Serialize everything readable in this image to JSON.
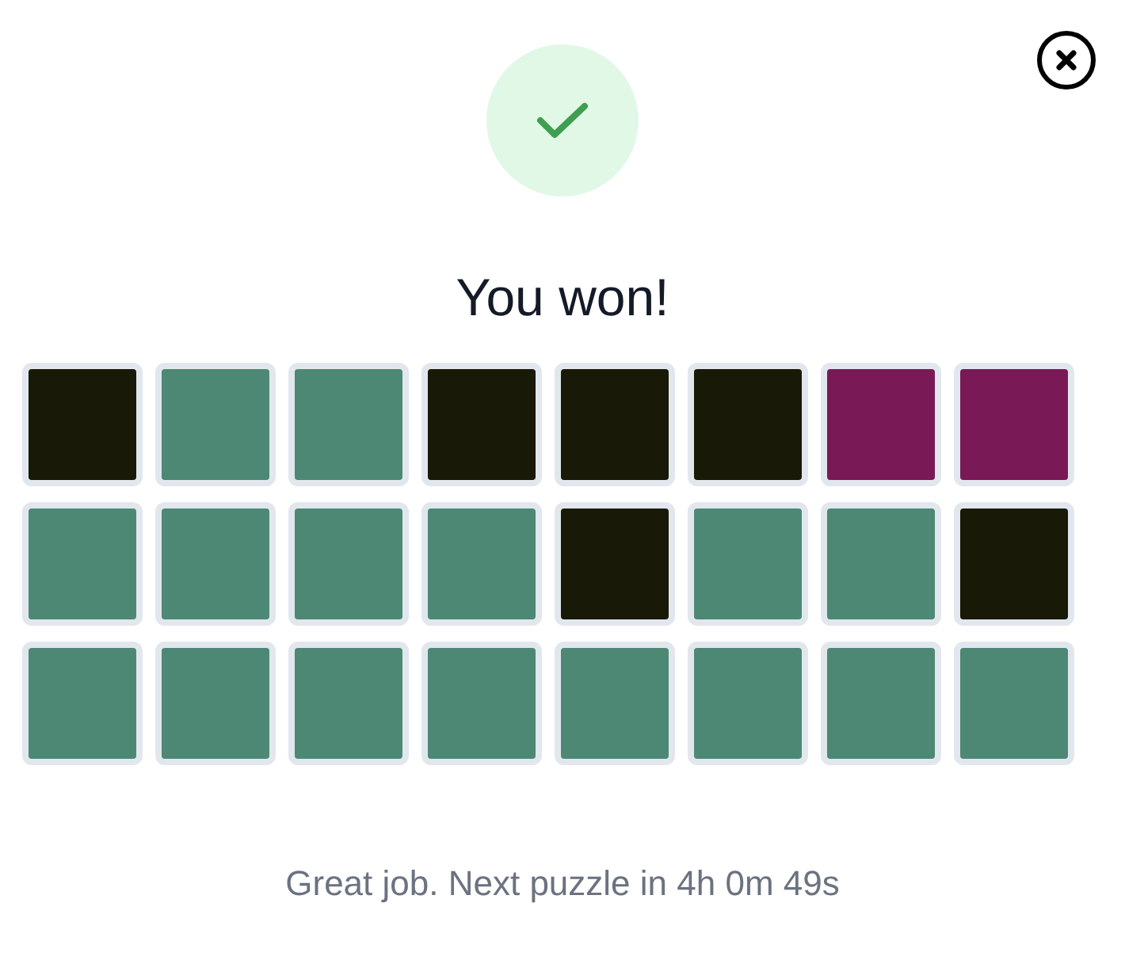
{
  "title": "You won!",
  "tiles": [
    [
      {
        "color": "#181906"
      },
      {
        "color": "#4d8874"
      },
      {
        "color": "#4d8874"
      },
      {
        "color": "#181906"
      },
      {
        "color": "#181906"
      },
      {
        "color": "#181906"
      },
      {
        "color": "#791a57"
      },
      {
        "color": "#791a57"
      }
    ],
    [
      {
        "color": "#4d8874"
      },
      {
        "color": "#4d8874"
      },
      {
        "color": "#4d8874"
      },
      {
        "color": "#4d8874"
      },
      {
        "color": "#181906"
      },
      {
        "color": "#4d8874"
      },
      {
        "color": "#4d8874"
      },
      {
        "color": "#181906"
      }
    ],
    [
      {
        "color": "#4d8874"
      },
      {
        "color": "#4d8874"
      },
      {
        "color": "#4d8874"
      },
      {
        "color": "#4d8874"
      },
      {
        "color": "#4d8874"
      },
      {
        "color": "#4d8874"
      },
      {
        "color": "#4d8874"
      },
      {
        "color": "#4d8874"
      }
    ]
  ],
  "message": "Great job. Next puzzle in 4h 0m 49s"
}
